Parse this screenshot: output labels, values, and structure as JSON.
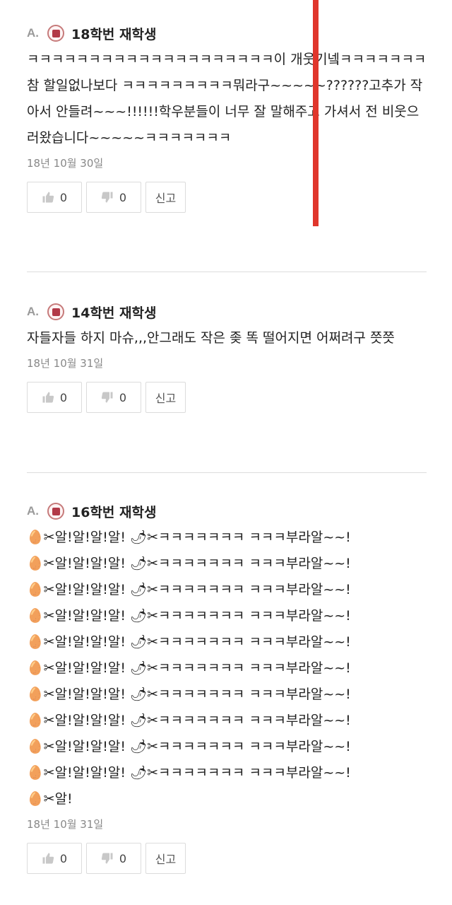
{
  "answers": [
    {
      "prefix": "A.",
      "author": "18학번 재학생",
      "text": "ㅋㅋㅋㅋㅋㅋㅋㅋㅋㅋㅋㅋㅋㅋㅋㅋㅋㅋㅋㅋ이 개웃기넼ㅋㅋㅋㅋㅋㅋㅋ참 할일없나보다 ㅋㅋㅋㅋㅋㅋㅋㅋㅋ뭐라구~~~~~??????고추가 작아서 안들려~~~!!!!!!학우분들이 너무 잘 말해주고 가셔서 전 비웃으러왔습니다~~~~~ㅋㅋㅋㅋㅋㅋㅋ",
      "date": "18년 10월 30일",
      "likes": "0",
      "dislikes": "0",
      "report": "신고"
    },
    {
      "prefix": "A.",
      "author": "14학번 재학생",
      "text": "자들자들 하지 마슈,,,안그래도 작은 좆 똑 떨어지면 어쩌려구 쯧쯧",
      "date": "18년 10월 31일",
      "likes": "0",
      "dislikes": "0",
      "report": "신고"
    },
    {
      "prefix": "A.",
      "author": "16학번 재학생",
      "lines": [
        "🥚✂알!알!알!알! 🌶✂ㅋㅋㅋㅋㅋㅋㅋ ㅋㅋㅋ부라알~~!",
        "🥚✂알!알!알!알! 🌶✂ㅋㅋㅋㅋㅋㅋㅋ ㅋㅋㅋ부라알~~!",
        "🥚✂알!알!알!알! 🌶✂ㅋㅋㅋㅋㅋㅋㅋ ㅋㅋㅋ부라알~~!",
        "🥚✂알!알!알!알! 🌶✂ㅋㅋㅋㅋㅋㅋㅋ ㅋㅋㅋ부라알~~!",
        "🥚✂알!알!알!알! 🌶✂ㅋㅋㅋㅋㅋㅋㅋ ㅋㅋㅋ부라알~~!",
        "🥚✂알!알!알!알! 🌶✂ㅋㅋㅋㅋㅋㅋㅋ ㅋㅋㅋ부라알~~!",
        "🥚✂알!알!알!알! 🌶✂ㅋㅋㅋㅋㅋㅋㅋ ㅋㅋㅋ부라알~~!",
        "🥚✂알!알!알!알! 🌶✂ㅋㅋㅋㅋㅋㅋㅋ ㅋㅋㅋ부라알~~!",
        "🥚✂알!알!알!알! 🌶✂ㅋㅋㅋㅋㅋㅋㅋ ㅋㅋㅋ부라알~~!",
        "🥚✂알!알!알!알! 🌶✂ㅋㅋㅋㅋㅋㅋㅋ ㅋㅋㅋ부라알~~!",
        "🥚✂알!"
      ],
      "date": "18년 10월 31일",
      "likes": "0",
      "dislikes": "0",
      "report": "신고"
    }
  ],
  "icons": {
    "university_seal": "university-seal-icon",
    "like": "thumbs-up-icon",
    "dislike": "thumbs-down-icon"
  },
  "colors": {
    "seal": "#b23a48",
    "overlay_line": "#e0362c",
    "meta_text": "#888888"
  }
}
